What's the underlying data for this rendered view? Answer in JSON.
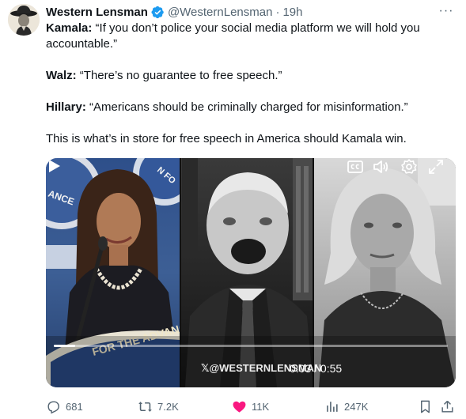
{
  "author": {
    "name": "Western Lensman",
    "handle": "@WesternLensman",
    "separator": "·",
    "time": "19h",
    "avatar_icon": "avatar-cowboy-hat"
  },
  "tweet": {
    "lines": [
      {
        "speaker": "Kamala:",
        "quote": "“If you don’t police your social media platform we will hold you accountable.”"
      },
      {
        "speaker": "Walz:",
        "quote": "“There’s no guarantee to free speech.”"
      },
      {
        "speaker": "Hillary:",
        "quote": "“Americans should be criminally charged for misinformation.”"
      }
    ],
    "closing": "This is what’s in store for free speech in America should Kamala win."
  },
  "video": {
    "watermark": "@WESTERNLENSMAN",
    "current_time": "0:03",
    "duration": "0:55",
    "timecode": "0:03 / 0:55",
    "progress_fraction": 0.055,
    "banner_text_left": "FOR THE ADVANCE",
    "banner_text_top": "ANCE",
    "banner_text_right": "N FO"
  },
  "actions": {
    "replies": "681",
    "reposts": "7.2K",
    "likes": "11K",
    "views": "247K"
  },
  "colors": {
    "text": "#0f1419",
    "muted": "#536471",
    "verified": "#1d9bf0",
    "repost": "#00ba7c",
    "like": "#f91880"
  }
}
